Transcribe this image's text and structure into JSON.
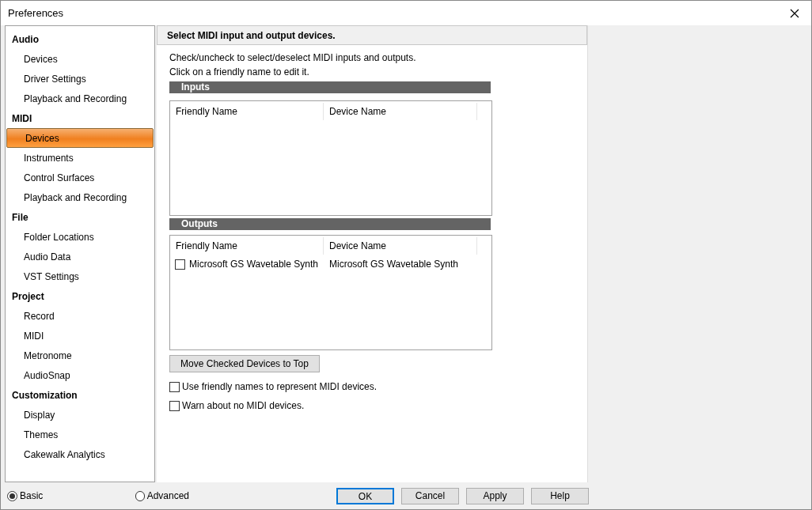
{
  "window": {
    "title": "Preferences"
  },
  "sidebar": {
    "groups": [
      {
        "label": "Audio",
        "children": [
          {
            "label": "Devices",
            "selected": false
          },
          {
            "label": "Driver Settings",
            "selected": false
          },
          {
            "label": "Playback and Recording",
            "selected": false
          }
        ]
      },
      {
        "label": "MIDI",
        "children": [
          {
            "label": "Devices",
            "selected": true
          },
          {
            "label": "Instruments",
            "selected": false
          },
          {
            "label": "Control Surfaces",
            "selected": false
          },
          {
            "label": "Playback and Recording",
            "selected": false
          }
        ]
      },
      {
        "label": "File",
        "children": [
          {
            "label": "Folder Locations",
            "selected": false
          },
          {
            "label": "Audio Data",
            "selected": false
          },
          {
            "label": "VST Settings",
            "selected": false
          }
        ]
      },
      {
        "label": "Project",
        "children": [
          {
            "label": "Record",
            "selected": false
          },
          {
            "label": "MIDI",
            "selected": false
          },
          {
            "label": "Metronome",
            "selected": false
          },
          {
            "label": "AudioSnap",
            "selected": false
          }
        ]
      },
      {
        "label": "Customization",
        "children": [
          {
            "label": "Display",
            "selected": false
          },
          {
            "label": "Themes",
            "selected": false
          },
          {
            "label": "Cakewalk Analytics",
            "selected": false
          }
        ]
      }
    ]
  },
  "panel": {
    "title": "Select MIDI input and output devices.",
    "instructions": [
      "Check/uncheck to select/deselect MIDI inputs and outputs.",
      "Click on a friendly name to edit it."
    ],
    "sections": [
      {
        "title": "Inputs",
        "columns": [
          "Friendly Name",
          "Device Name"
        ]
      },
      {
        "title": "Outputs",
        "columns": [
          "Friendly Name",
          "Device Name"
        ],
        "rows": [
          {
            "friendly_name": "Microsoft GS Wavetable Synth",
            "device_name": "Microsoft GS Wavetable Synth",
            "checked": false
          }
        ]
      }
    ],
    "move_button": "Move Checked Devices to Top",
    "options": [
      {
        "label": "Use friendly names to represent MIDI devices.",
        "checked": false
      },
      {
        "label": "Warn about no MIDI devices.",
        "checked": false
      }
    ]
  },
  "mode": [
    {
      "label": "Basic",
      "selected": true
    },
    {
      "label": "Advanced",
      "selected": false
    }
  ],
  "buttons": [
    {
      "label": "OK",
      "default": true
    },
    {
      "label": "Cancel",
      "default": false
    },
    {
      "label": "Apply",
      "default": false
    },
    {
      "label": "Help",
      "default": false
    }
  ]
}
